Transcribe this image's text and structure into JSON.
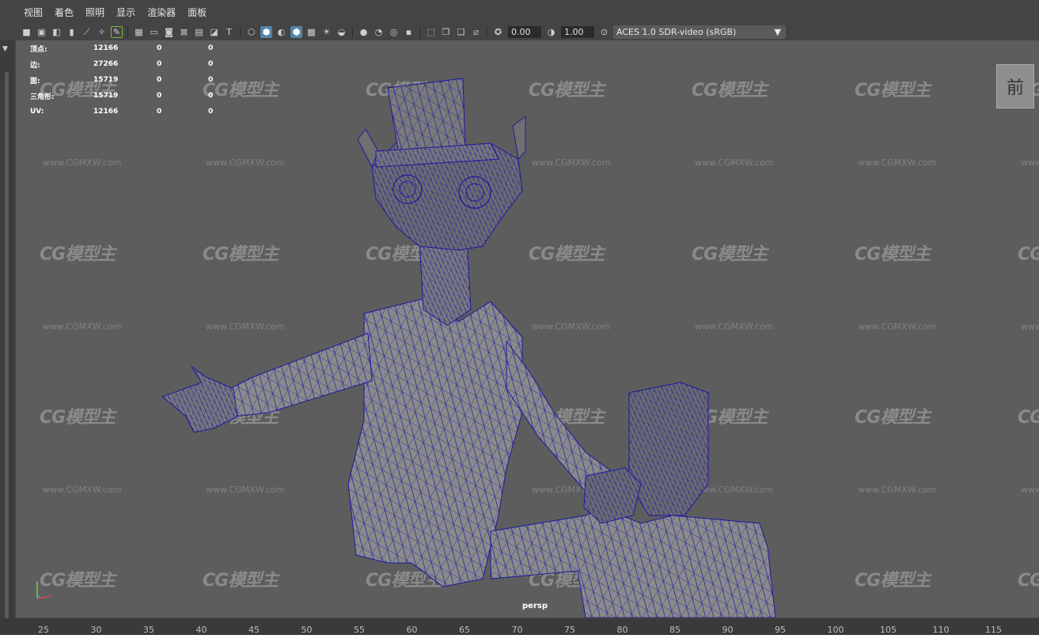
{
  "menu": [
    "视图",
    "着色",
    "照明",
    "显示",
    "渲染器",
    "面板"
  ],
  "toolbar": {
    "field_a": "0.00",
    "field_b": "1.00",
    "color_management": "ACES 1.0 SDR-video (sRGB)"
  },
  "hud": [
    {
      "label": "顶点:",
      "v1": "12166",
      "v2": "0",
      "v3": "0"
    },
    {
      "label": "边:",
      "v1": "27266",
      "v2": "0",
      "v3": "0"
    },
    {
      "label": "面:",
      "v1": "15719",
      "v2": "0",
      "v3": "0"
    },
    {
      "label": "三角形:",
      "v1": "15719",
      "v2": "0",
      "v3": "0"
    },
    {
      "label": "UV:",
      "v1": "12166",
      "v2": "0",
      "v3": "0"
    }
  ],
  "viewcube_label": "前",
  "camera": "persp",
  "watermark": {
    "logo": "CG模型主",
    "url": "www.CGMXW.com"
  },
  "timeline_ticks": [
    "25",
    "30",
    "35",
    "40",
    "45",
    "50",
    "55",
    "60",
    "65",
    "70",
    "75",
    "80",
    "85",
    "90",
    "95",
    "100",
    "105",
    "110",
    "115"
  ],
  "colors": {
    "wire": "#1a1aa0",
    "viewport": "#5d5d5d",
    "accent": "#5285a6"
  }
}
